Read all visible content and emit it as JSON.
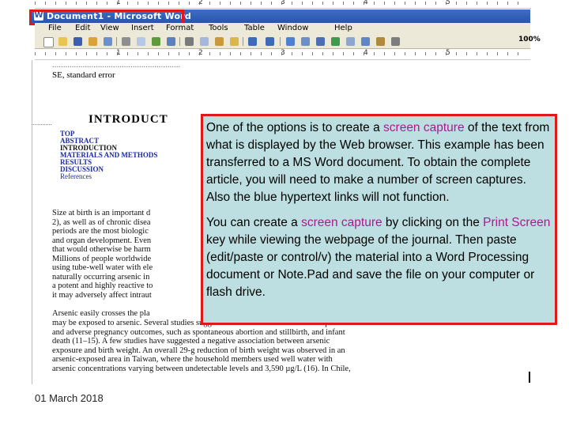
{
  "ruler_top": {
    "numbers": [
      "1",
      "2",
      "3",
      "4",
      "5"
    ]
  },
  "window": {
    "title": "Document1 - Microsoft Word",
    "app_icon_letter": "W"
  },
  "menu": {
    "items": [
      "File",
      "Edit",
      "View",
      "Insert",
      "Format",
      "Tools",
      "Table",
      "Window",
      "Help"
    ]
  },
  "toolbar": {
    "zoom": "100%",
    "icons": [
      "new-document-icon",
      "open-folder-icon",
      "save-icon",
      "permission-icon",
      "email-icon",
      "print-icon",
      "print-preview-icon",
      "spelling-icon",
      "research-icon",
      "cut-icon",
      "copy-icon",
      "paste-icon",
      "format-painter-icon",
      "undo-icon",
      "redo-icon",
      "hyperlink-icon",
      "tables-borders-icon",
      "insert-table-icon",
      "insert-excel-icon",
      "columns-icon",
      "drawing-icon",
      "document-map-icon",
      "show-hide-icon"
    ]
  },
  "ruler2": {
    "numbers": [
      "1",
      "2",
      "3",
      "4",
      "5"
    ]
  },
  "document": {
    "top_fragment_line1": "...........................................................",
    "top_fragment_line2": "SE, standard error",
    "intro_heading": "INTRODUCT",
    "toc": [
      "TOP",
      "ABSTRACT",
      "INTRODUCTION",
      "MATERIALS AND METHODS",
      "RESULTS",
      "DISCUSSION",
      "References"
    ],
    "para1": [
      "Size at birth is an important d",
      "2), as well as of chronic disea",
      "periods are the most biologic",
      "and organ development. Even",
      "that would otherwise be harm",
      "Millions of people worldwide",
      "using tube-well water with ele",
      "naturally occurring arsenic in",
      "a potent and highly reactive to",
      "it may adversely affect intraut"
    ],
    "para2_line1": "Arsenic easily crosses the pla",
    "para2_rest": [
      "may be exposed to arsenic. Several studies suggest association between arsenic exposure",
      "and adverse pregnancy outcomes, such as spontaneous abortion and stillbirth, and infant",
      "death (11–15). A few studies have suggested a negative association between arsenic",
      "exposure and birth weight. An overall 29-g reduction of birth weight was observed in an",
      "arsenic-exposed area in Taiwan, where the household members used well water with",
      "arsenic concentrations varying between undetectable levels and 3,590 µg/L (16). In Chile,"
    ]
  },
  "callout": {
    "p1_a": "One of the options is to create a ",
    "p1_hl": "screen capture",
    "p1_b": " of the text from what is displayed by the Web browser.  This example has been transferred to a MS Word document.  To obtain the complete article, you will need to make a number of screen captures.  Also the blue hypertext links will not function.",
    "p2_a": "You can create a ",
    "p2_hl1": "screen capture",
    "p2_b": " by clicking on the ",
    "p2_hl2": "Print Screen",
    "p2_c": " key while viewing the webpage of the journal.  Then paste (edit/paste or control/v) the material into a Word Processing document or Note.Pad and save the file on your computer or flash drive."
  },
  "footer": {
    "date": "01 March 2018"
  },
  "colors": {
    "highlight": "#b0178f",
    "callout_border": "#e01818",
    "callout_bg": "#bedfe1",
    "link": "#1a2aa8"
  }
}
